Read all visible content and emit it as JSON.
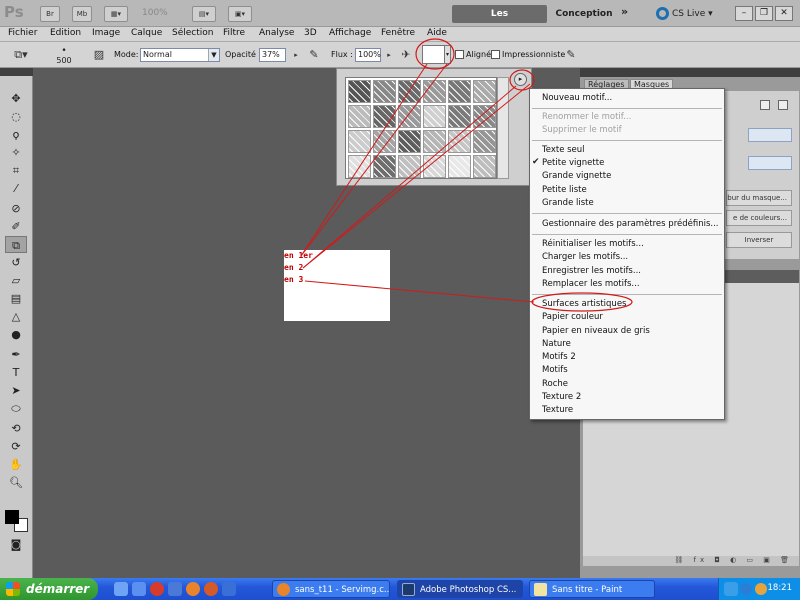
{
  "titlebar": {
    "app_logo": "Ps",
    "br_label": "Br",
    "mb_label": "Mb",
    "zoom": "100%",
    "workspace_active": "Les indispensables",
    "workspace_other": "Conception",
    "workspace_more": "»",
    "cslive": "CS Live"
  },
  "menubar": [
    "Fichier",
    "Edition",
    "Image",
    "Calque",
    "Sélection",
    "Filtre",
    "Analyse",
    "3D",
    "Affichage",
    "Fenêtre",
    "Aide"
  ],
  "options": {
    "brush_size": "500",
    "mode_label": "Mode:",
    "mode_value": "Normal",
    "opacity_label": "Opacité :",
    "opacity_value": "37%",
    "flux_label": "Flux :",
    "flux_value": "100%",
    "aligned_label": "Aligné",
    "impressionist_label": "Impressionniste"
  },
  "right_dock": {
    "tab1": "Réglages",
    "tab2": "Masques",
    "btn_mask": "bur du masque...",
    "btn_colors": "e de couleurs...",
    "btn_invert": "Inverser"
  },
  "document": {
    "lines": [
      "en 1er",
      "en 2",
      "en 3"
    ]
  },
  "pattern_menu": {
    "new": "Nouveau motif...",
    "rename": "Renommer le motif...",
    "delete": "Supprimer le motif",
    "view_text": "Texte seul",
    "view_small_thumb": "Petite vignette",
    "view_large_thumb": "Grande vignette",
    "view_small_list": "Petite liste",
    "view_large_list": "Grande liste",
    "preset_manager": "Gestionnaire des paramètres prédéfinis...",
    "reset": "Réinitialiser les motifs...",
    "load": "Charger les motifs...",
    "save": "Enregistrer les motifs...",
    "replace": "Remplacer les motifs...",
    "libraries": [
      "Surfaces artistiques",
      "Papier couleur",
      "Papier en niveaux de gris",
      "Nature",
      "Motifs 2",
      "Motifs",
      "Roche",
      "Texture 2",
      "Texture"
    ]
  },
  "taskbar": {
    "start": "démarrer",
    "tasks": [
      "sans_t11 - Servimg.c...",
      "Adobe Photoshop CS...",
      "Sans titre - Paint"
    ],
    "clock": "18:21"
  },
  "colors": {
    "annotation": "#d11a1a",
    "ws_active_bg": "#6b6b6b",
    "taskbar_blue": "#2458d8",
    "start_green": "#3aa33a"
  }
}
